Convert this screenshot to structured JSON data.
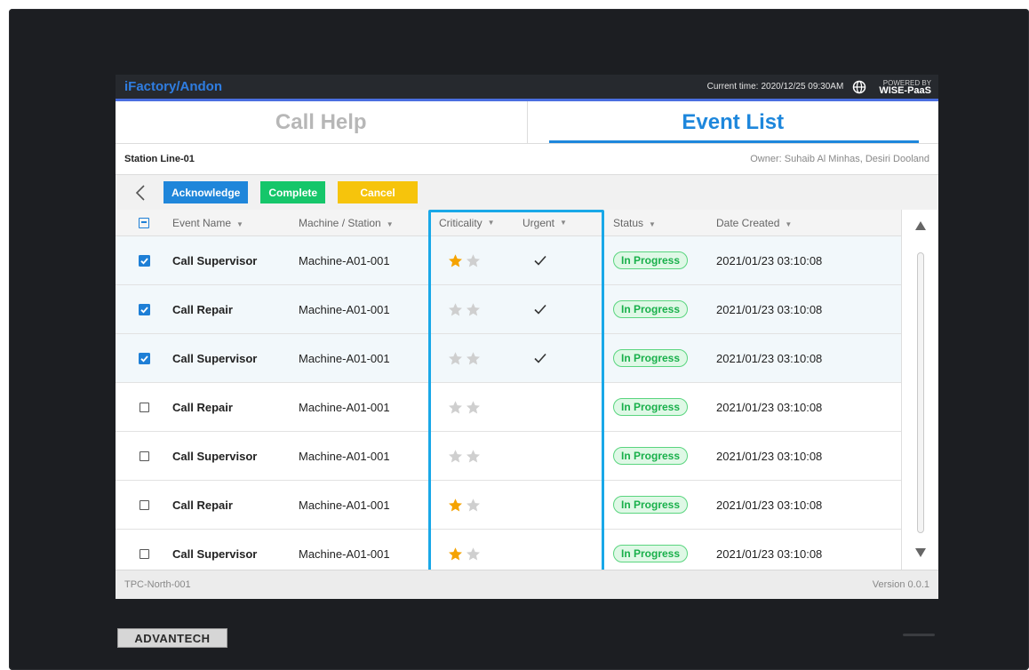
{
  "device": {
    "brand_logo": "ADVANTECH"
  },
  "topbar": {
    "app_title": "iFactory/Andon",
    "clock_label": "Current time:",
    "clock_value": "2020/12/25  09:30AM",
    "globe_icon": "globe-icon",
    "powered_line1": "POWERED BY",
    "powered_line2": "WISE-PaaS"
  },
  "tabs": [
    {
      "label": "Call Help",
      "active": false
    },
    {
      "label": "Event List",
      "active": true
    }
  ],
  "station": {
    "name": "Station Line-01",
    "owner": "Owner: Suhaib Al Minhas, Desiri Dooland"
  },
  "toolbar": {
    "back_icon": "chevron-left-icon",
    "acknowledge_label": "Acknowledge",
    "complete_label": "Complete",
    "cancel_label": "Cancel"
  },
  "table": {
    "headers": {
      "event_name": "Event Name",
      "machine": "Machine / Station",
      "criticality": "Criticality",
      "urgent": "Urgent",
      "status": "Status",
      "date": "Date Created"
    },
    "rows": [
      {
        "checked": true,
        "event": "Call Supervisor",
        "machine": "Machine-A01-001",
        "criticality": 1,
        "urgent": true,
        "status": "In Progress",
        "date": "2021/01/23 03:10:08"
      },
      {
        "checked": true,
        "event": "Call Repair",
        "machine": "Machine-A01-001",
        "criticality": 0,
        "urgent": true,
        "status": "In Progress",
        "date": "2021/01/23 03:10:08"
      },
      {
        "checked": true,
        "event": "Call Supervisor",
        "machine": "Machine-A01-001",
        "criticality": 0,
        "urgent": true,
        "status": "In Progress",
        "date": "2021/01/23 03:10:08"
      },
      {
        "checked": false,
        "event": "Call Repair",
        "machine": "Machine-A01-001",
        "criticality": 0,
        "urgent": false,
        "status": "In Progress",
        "date": "2021/01/23 03:10:08"
      },
      {
        "checked": false,
        "event": "Call Supervisor",
        "machine": "Machine-A01-001",
        "criticality": 0,
        "urgent": false,
        "status": "In Progress",
        "date": "2021/01/23 03:10:08"
      },
      {
        "checked": false,
        "event": "Call Repair",
        "machine": "Machine-A01-001",
        "criticality": 1,
        "urgent": false,
        "status": "In Progress",
        "date": "2021/01/23 03:10:08"
      },
      {
        "checked": false,
        "event": "Call Supervisor",
        "machine": "Machine-A01-001",
        "criticality": 1,
        "urgent": false,
        "status": "In Progress",
        "date": "2021/01/23 03:10:08"
      }
    ]
  },
  "footer": {
    "device_id": "TPC-North-001",
    "version": "Version 0.0.1"
  },
  "colors": {
    "accent_blue": "#1e87dc",
    "complete_green": "#15c66a",
    "cancel_yellow": "#f6c40c",
    "star_on": "#f5a300",
    "star_off": "#cfcfcf",
    "highlight": "#19a8e8"
  }
}
